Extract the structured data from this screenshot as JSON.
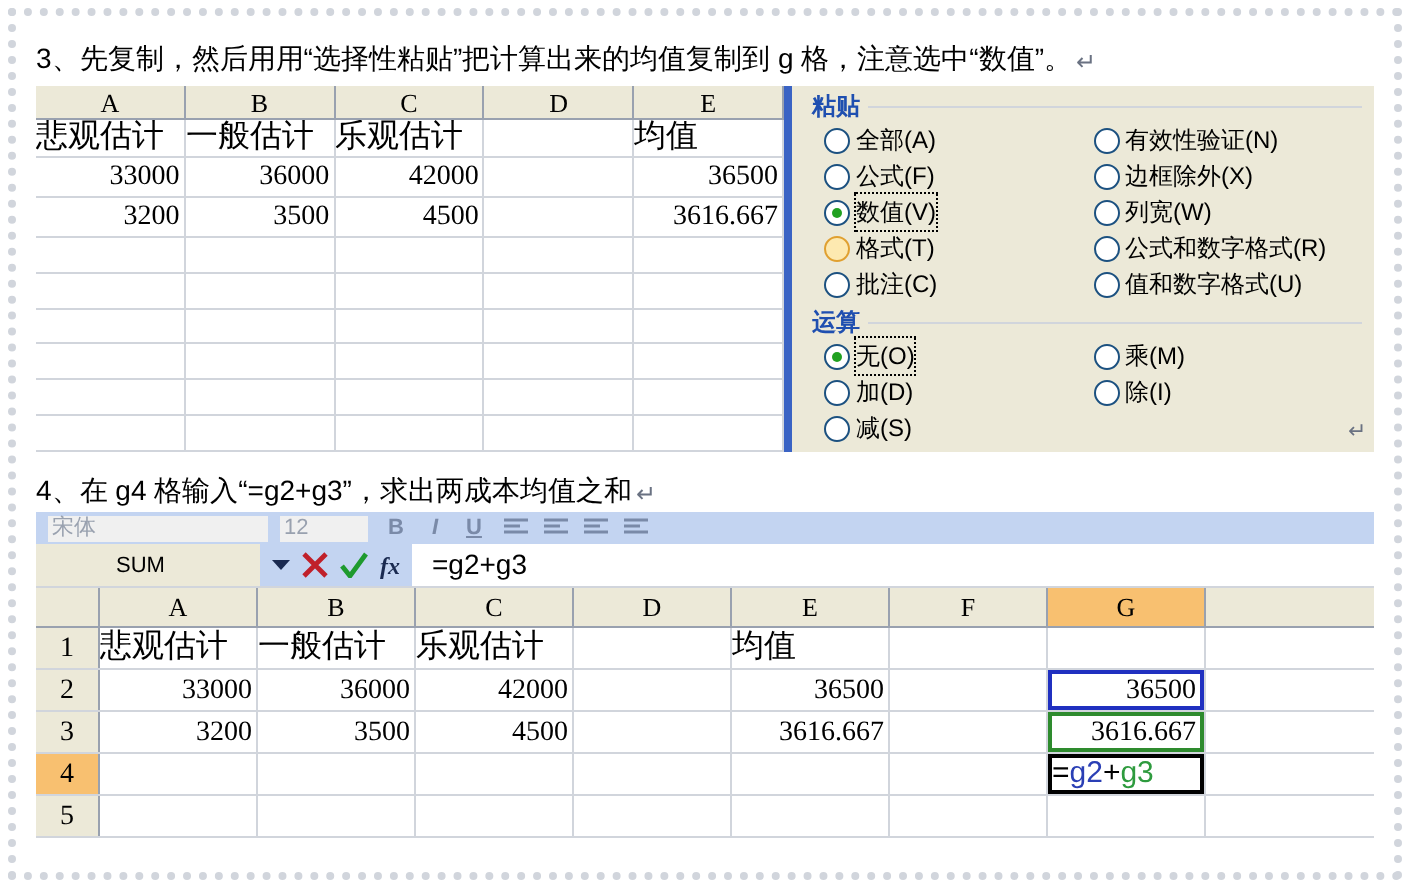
{
  "step3": {
    "text": "3、先复制，然后用用“选择性粘贴”把计算出来的均值复制到 g 格，注意选中“数值”。",
    "mark": "↵"
  },
  "sheet1": {
    "columns": [
      "A",
      "B",
      "C",
      "D",
      "E"
    ],
    "rows": [
      [
        "悲观估计",
        "一般估计",
        "乐观估计",
        null,
        "均值"
      ],
      [
        "33000",
        "36000",
        "42000",
        null,
        "36500"
      ],
      [
        "3200",
        "3500",
        "4500",
        null,
        "3616.667"
      ]
    ]
  },
  "dialog": {
    "groups": [
      {
        "title": "粘贴",
        "options": [
          {
            "label": "全部(A)",
            "selected": false,
            "hovered": false
          },
          {
            "label": "有效性验证(N)",
            "selected": false,
            "hovered": false
          },
          {
            "label": "公式(F)",
            "selected": false,
            "hovered": false
          },
          {
            "label": "边框除外(X)",
            "selected": false,
            "hovered": false
          },
          {
            "label": "数值(V)",
            "selected": true,
            "hovered": false
          },
          {
            "label": "列宽(W)",
            "selected": false,
            "hovered": false
          },
          {
            "label": "格式(T)",
            "selected": false,
            "hovered": true
          },
          {
            "label": "公式和数字格式(R)",
            "selected": false,
            "hovered": false
          },
          {
            "label": "批注(C)",
            "selected": false,
            "hovered": false
          },
          {
            "label": "值和数字格式(U)",
            "selected": false,
            "hovered": false
          }
        ]
      },
      {
        "title": "运算",
        "options": [
          {
            "label": "无(O)",
            "selected": true,
            "hovered": false
          },
          {
            "label": "乘(M)",
            "selected": false,
            "hovered": false
          },
          {
            "label": "加(D)",
            "selected": false,
            "hovered": false
          },
          {
            "label": "除(I)",
            "selected": false,
            "hovered": false
          },
          {
            "label": "减(S)",
            "selected": false,
            "hovered": false
          }
        ]
      }
    ],
    "mark": "↵"
  },
  "step4": {
    "text": "4、在 g4 格输入“=g2+g3”，求出两成本均值之和",
    "mark": "↵"
  },
  "toolbar": {
    "font": "宋体",
    "size": "12",
    "buttons": [
      "B",
      "I",
      "U"
    ]
  },
  "formula_bar": {
    "name_box": "SUM",
    "fx": "fx",
    "formula": "=g2+g3"
  },
  "sheet2": {
    "columns": [
      {
        "label": "A",
        "selected": false
      },
      {
        "label": "B",
        "selected": false
      },
      {
        "label": "C",
        "selected": false
      },
      {
        "label": "D",
        "selected": false
      },
      {
        "label": "E",
        "selected": false
      },
      {
        "label": "F",
        "selected": false
      },
      {
        "label": "G",
        "selected": true
      }
    ],
    "rows": [
      {
        "number": "1",
        "selected": false,
        "cells": [
          "悲观估计",
          "一般估计",
          "乐观估计",
          null,
          "均值",
          null,
          null
        ]
      },
      {
        "number": "2",
        "selected": false,
        "cells": [
          "33000",
          "36000",
          "42000",
          null,
          "36500",
          null,
          {
            "text": "36500",
            "color": "#2030c0"
          }
        ]
      },
      {
        "number": "3",
        "selected": false,
        "cells": [
          "3200",
          "3500",
          "4500",
          null,
          "3616.667",
          null,
          {
            "text": "3616.667",
            "color": "#2e8b2e"
          }
        ]
      },
      {
        "number": "4",
        "selected": true,
        "cells": [
          null,
          null,
          null,
          null,
          null,
          null,
          {
            "kind": "editing",
            "segments": [
              {
                "text": "="
              },
              {
                "text": "g2",
                "color": "#2a3fb5"
              },
              {
                "text": "+"
              },
              {
                "text": "g3",
                "color": "#2e9b3e"
              }
            ]
          }
        ]
      },
      {
        "number": "5",
        "selected": false,
        "cells": [
          null,
          null,
          null,
          null,
          null,
          null,
          null
        ]
      }
    ]
  }
}
